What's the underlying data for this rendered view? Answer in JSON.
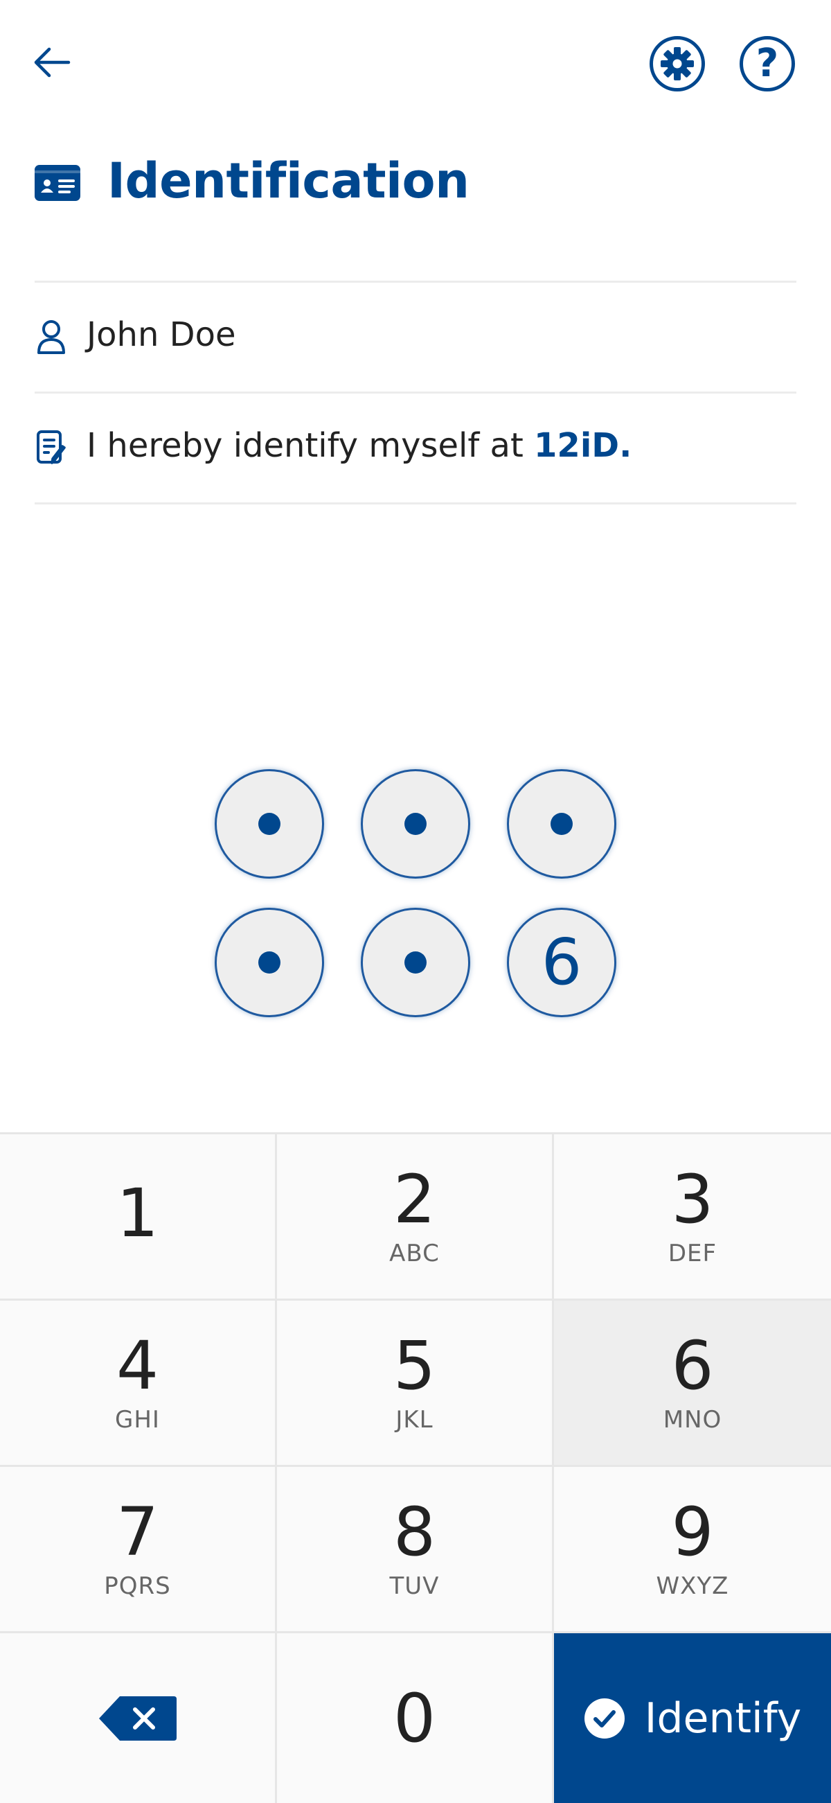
{
  "header": {
    "back_icon": "arrow-left-icon",
    "settings_icon": "gear-icon",
    "help_icon": "question-mark-icon",
    "help_glyph": "?"
  },
  "title": {
    "icon": "id-card-icon",
    "text": "Identification"
  },
  "info_rows": {
    "user": {
      "icon": "person-icon",
      "name": "John Doe"
    },
    "statement": {
      "icon": "document-pen-icon",
      "text": "I hereby identify myself at ",
      "brand": "12iD."
    }
  },
  "pin": {
    "length": 6,
    "visible_digit": "6",
    "masked_count": 5
  },
  "keypad": {
    "keys": [
      {
        "num": "1",
        "letters": ""
      },
      {
        "num": "2",
        "letters": "ABC"
      },
      {
        "num": "3",
        "letters": "DEF"
      },
      {
        "num": "4",
        "letters": "GHI"
      },
      {
        "num": "5",
        "letters": "JKL"
      },
      {
        "num": "6",
        "letters": "MNO"
      },
      {
        "num": "7",
        "letters": "PQRS"
      },
      {
        "num": "8",
        "letters": "TUV"
      },
      {
        "num": "9",
        "letters": "WXYZ"
      }
    ],
    "zero": "0",
    "backspace_icon": "backspace-icon",
    "submit_icon": "check-circle-icon",
    "submit_label": "Identify",
    "pressed_key": "6"
  },
  "colors": {
    "brand": "#00478e",
    "key_background": "#fafafa",
    "key_pressed": "#eeeeee",
    "divider": "#e6e6e6"
  }
}
